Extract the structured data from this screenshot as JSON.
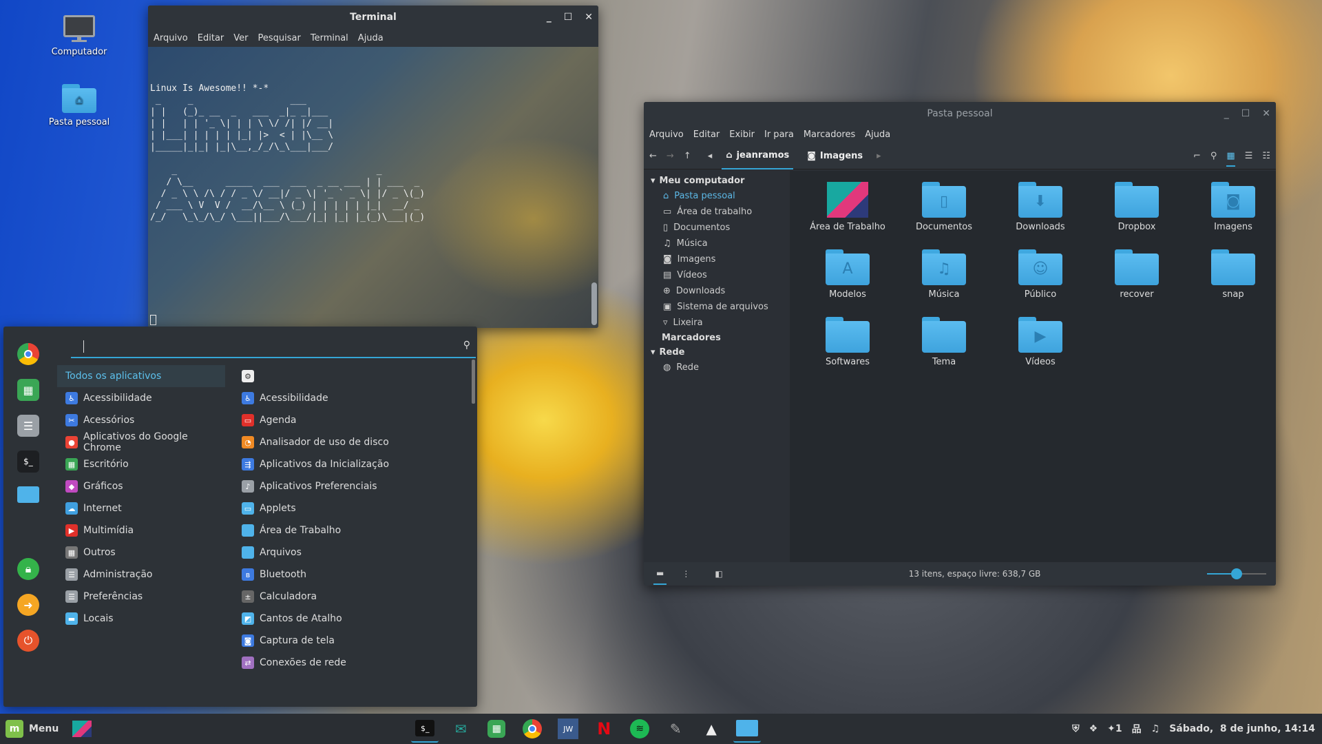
{
  "desktop": {
    "icons": [
      {
        "label": "Computador",
        "icon": "monitor-icon"
      },
      {
        "label": "Pasta pessoal",
        "icon": "home-folder-icon"
      }
    ]
  },
  "terminal": {
    "title": "Terminal",
    "menu": [
      "Arquivo",
      "Editar",
      "Ver",
      "Pesquisar",
      "Terminal",
      "Ajuda"
    ],
    "output": "Linux Is Awesome!! *-*\n _     _                  ___\n| |   (_)_ __  _   ___  _|_ _|___\n| |   | | '_ \\| | | \\ \\/ /| |/ __|\n| |___| | | | | |_| |>  < | |\\__ \\\n|_____|_|_| |_|\\__,_/_/\\_\\___|___/\n\n    _                                     _\n   / \\__      _____  ___  ___  _ __ ___ | | ___  _\n  / _ \\ \\ /\\ / / _ \\/ __|/ _ \\| '_ ` _ \\| |/ _ \\(_)\n / ___ \\ V  V /  __/\\__ \\ (_) | | | | | |_|  __/ _\n/_/   \\_\\_/\\_/ \\___||___/\\___/|_| |_| |_(_)\\___|(_)"
  },
  "files": {
    "title": "Pasta pessoal",
    "menu": [
      "Arquivo",
      "Editar",
      "Exibir",
      "Ir para",
      "Marcadores",
      "Ajuda"
    ],
    "breadcrumb": [
      "jeanramos",
      "Imagens"
    ],
    "sidebar": {
      "computer_header": "Meu computador",
      "items": [
        "Pasta pessoal",
        "Área de trabalho",
        "Documentos",
        "Música",
        "Imagens",
        "Vídeos",
        "Downloads",
        "Sistema de arquivos",
        "Lixeira"
      ],
      "bookmarks_header": "Marcadores",
      "network_header": "Rede",
      "network_items": [
        "Rede"
      ]
    },
    "items": [
      {
        "label": "Área de Trabalho",
        "icon": "desktop-folder-icon"
      },
      {
        "label": "Documentos",
        "icon": "documents-folder-icon"
      },
      {
        "label": "Downloads",
        "icon": "downloads-folder-icon"
      },
      {
        "label": "Dropbox",
        "icon": "folder-icon"
      },
      {
        "label": "Imagens",
        "icon": "pictures-folder-icon"
      },
      {
        "label": "Modelos",
        "icon": "templates-folder-icon"
      },
      {
        "label": "Música",
        "icon": "music-folder-icon"
      },
      {
        "label": "Público",
        "icon": "public-folder-icon"
      },
      {
        "label": "recover",
        "icon": "folder-icon"
      },
      {
        "label": "snap",
        "icon": "folder-icon"
      },
      {
        "label": "Softwares",
        "icon": "folder-icon"
      },
      {
        "label": "Tema",
        "icon": "folder-icon"
      },
      {
        "label": "Vídeos",
        "icon": "videos-folder-icon"
      }
    ],
    "status": "13 itens, espaço livre: 638,7 GB",
    "zoom_level": 0.5
  },
  "startmenu": {
    "search_value": "",
    "categories": [
      "Todos os aplicativos",
      "Acessibilidade",
      "Acessórios",
      "Aplicativos do Google Chrome",
      "Escritório",
      "Gráficos",
      "Internet",
      "Multimídia",
      "Outros",
      "Administração",
      "Preferências",
      "Locais"
    ],
    "apps": [
      "Acessibilidade",
      "Agenda",
      "Analisador de uso de disco",
      "Aplicativos da Inicialização",
      "Aplicativos Preferenciais",
      "Applets",
      "Área de Trabalho",
      "Arquivos",
      "Bluetooth",
      "Calculadora",
      "Cantos de Atalho",
      "Captura de tela",
      "Conexões de rede"
    ]
  },
  "panel": {
    "menu_label": "Menu",
    "tray_notification_count": "1",
    "clock": "Sábado,  8 de junho, 14:14"
  },
  "colors": {
    "accent": "#35a6d6",
    "folder": "#4fb3ea"
  }
}
